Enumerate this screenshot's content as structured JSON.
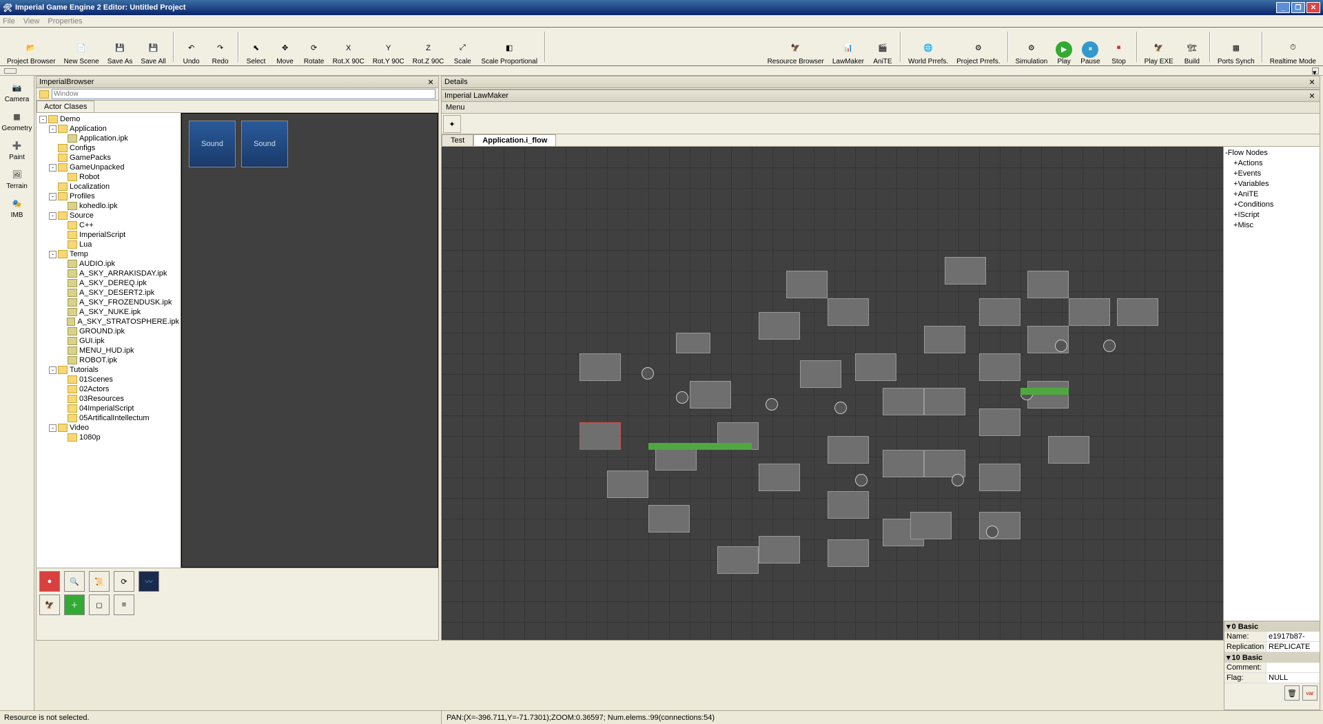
{
  "title": "Imperial Game Engine 2 Editor:  Untitled Project",
  "menu": {
    "file": "File",
    "view": "View",
    "properties": "Properties"
  },
  "toolbar": [
    {
      "id": "project-browser",
      "label": "Project Browser",
      "icon": "📂"
    },
    {
      "id": "new-scene",
      "label": "New Scene",
      "icon": "📄"
    },
    {
      "id": "save-as",
      "label": "Save As",
      "icon": "💾"
    },
    {
      "id": "save-all",
      "label": "Save All",
      "icon": "💾"
    },
    {
      "sep": true
    },
    {
      "id": "undo",
      "label": "Undo",
      "icon": "↶"
    },
    {
      "id": "redo",
      "label": "Redo",
      "icon": "↷"
    },
    {
      "sep": true
    },
    {
      "id": "select",
      "label": "Select",
      "icon": "⬉"
    },
    {
      "id": "move",
      "label": "Move",
      "icon": "✥"
    },
    {
      "id": "rotate",
      "label": "Rotate",
      "icon": "⟳"
    },
    {
      "id": "rotx",
      "label": "Rot.X 90C",
      "icon": "X"
    },
    {
      "id": "roty",
      "label": "Rot.Y 90C",
      "icon": "Y"
    },
    {
      "id": "rotz",
      "label": "Rot.Z 90C",
      "icon": "Z"
    },
    {
      "id": "scale",
      "label": "Scale",
      "icon": "⤢"
    },
    {
      "id": "scaleprop",
      "label": "Scale Proportional",
      "icon": "◧"
    },
    {
      "sep": true
    },
    {
      "spacer": true
    },
    {
      "id": "resourcebrowser",
      "label": "Resource Browser",
      "icon": "🦅"
    },
    {
      "id": "lawmaker",
      "label": "LawMaker",
      "icon": "📊"
    },
    {
      "id": "anite",
      "label": "AniTE",
      "icon": "🎬"
    },
    {
      "sep": true
    },
    {
      "id": "worldprefs",
      "label": "World Prrefs.",
      "icon": "🌐"
    },
    {
      "id": "projectprefs",
      "label": "Project Prrefs.",
      "icon": "⚙"
    },
    {
      "sep": true
    },
    {
      "id": "simulation",
      "label": "Simulation",
      "icon": "⚙"
    },
    {
      "id": "play",
      "label": "Play",
      "icon": "▶"
    },
    {
      "id": "pause",
      "label": "Pause",
      "icon": "⏸"
    },
    {
      "id": "stop",
      "label": "Stop",
      "icon": "⏹"
    },
    {
      "sep": true
    },
    {
      "id": "playexe",
      "label": "Play EXE",
      "icon": "🦅"
    },
    {
      "id": "build",
      "label": "Build",
      "icon": "🏗"
    },
    {
      "sep": true
    },
    {
      "id": "portssynch",
      "label": "Ports Synch",
      "icon": "▦"
    },
    {
      "sep": true
    },
    {
      "id": "realtimemode",
      "label": "Realtime Mode",
      "icon": "⏱"
    }
  ],
  "rail": [
    {
      "id": "camera",
      "label": "Camera",
      "icon": "📷"
    },
    {
      "id": "geometry",
      "label": "Geometry",
      "icon": "▦"
    },
    {
      "id": "paint",
      "label": "Paint",
      "icon": "➕"
    },
    {
      "id": "terrain",
      "label": "Terrain",
      "icon": "🖼"
    },
    {
      "id": "imb",
      "label": "IMB",
      "icon": "🎭"
    }
  ],
  "browser": {
    "title": "ImperialBrowser",
    "addr": "Window",
    "tab": "Actor Clases",
    "thumbs": [
      "Sound",
      "Sound"
    ],
    "tree": [
      {
        "t": "Demo",
        "exp": "-",
        "lvl": 0,
        "f": 1
      },
      {
        "t": "Application",
        "exp": "-",
        "lvl": 1,
        "f": 1
      },
      {
        "t": "Application.ipk",
        "lvl": 2,
        "file": 1
      },
      {
        "t": "Configs",
        "lvl": 1,
        "f": 1
      },
      {
        "t": "GamePacks",
        "lvl": 1,
        "f": 1
      },
      {
        "t": "GameUnpacked",
        "exp": "-",
        "lvl": 1,
        "f": 1
      },
      {
        "t": "Robot",
        "lvl": 2,
        "f": 1
      },
      {
        "t": "Localization",
        "lvl": 1,
        "f": 1
      },
      {
        "t": "Profiles",
        "exp": "-",
        "lvl": 1,
        "f": 1
      },
      {
        "t": "kohedlo.ipk",
        "lvl": 2,
        "file": 1
      },
      {
        "t": "Source",
        "exp": "-",
        "lvl": 1,
        "f": 1
      },
      {
        "t": "C++",
        "lvl": 2,
        "f": 1
      },
      {
        "t": "ImperialScript",
        "lvl": 2,
        "f": 1
      },
      {
        "t": "Lua",
        "lvl": 2,
        "f": 1
      },
      {
        "t": "Temp",
        "exp": "-",
        "lvl": 1,
        "f": 1
      },
      {
        "t": "AUDIO.ipk",
        "lvl": 2,
        "file": 1
      },
      {
        "t": "A_SKY_ARRAKISDAY.ipk",
        "lvl": 2,
        "file": 1
      },
      {
        "t": "A_SKY_DEREQ.ipk",
        "lvl": 2,
        "file": 1
      },
      {
        "t": "A_SKY_DESERT2.ipk",
        "lvl": 2,
        "file": 1
      },
      {
        "t": "A_SKY_FROZENDUSK.ipk",
        "lvl": 2,
        "file": 1
      },
      {
        "t": "A_SKY_NUKE.ipk",
        "lvl": 2,
        "file": 1
      },
      {
        "t": "A_SKY_STRATOSPHERE.ipk",
        "lvl": 2,
        "file": 1
      },
      {
        "t": "GROUND.ipk",
        "lvl": 2,
        "file": 1
      },
      {
        "t": "GUI.ipk",
        "lvl": 2,
        "file": 1
      },
      {
        "t": "MENU_HUD.ipk",
        "lvl": 2,
        "file": 1
      },
      {
        "t": "ROBOT.ipk",
        "lvl": 2,
        "file": 1
      },
      {
        "t": "Tutorials",
        "exp": "-",
        "lvl": 1,
        "f": 1
      },
      {
        "t": "01Scenes",
        "lvl": 2,
        "f": 1
      },
      {
        "t": "02Actors",
        "lvl": 2,
        "f": 1
      },
      {
        "t": "03Resources",
        "lvl": 2,
        "f": 1
      },
      {
        "t": "04ImperialScript",
        "lvl": 2,
        "f": 1
      },
      {
        "t": "05ArtificalIntellectum",
        "lvl": 2,
        "f": 1
      },
      {
        "t": "Video",
        "exp": "-",
        "lvl": 1,
        "f": 1
      },
      {
        "t": "1080p",
        "lvl": 2,
        "f": 1
      }
    ]
  },
  "details": {
    "title": "Details"
  },
  "lawmaker": {
    "title": "Imperial LawMaker",
    "menu": "Menu",
    "tabs": [
      {
        "label": "Test",
        "active": false
      },
      {
        "label": "Application.i_flow",
        "active": true
      }
    ],
    "flownodes": [
      {
        "t": "Flow Nodes",
        "exp": "-",
        "lvl": 0
      },
      {
        "t": "Actions",
        "exp": "+",
        "lvl": 1
      },
      {
        "t": "Events",
        "exp": "+",
        "lvl": 1
      },
      {
        "t": "Variables",
        "exp": "+",
        "lvl": 1
      },
      {
        "t": "AniTE",
        "exp": "+",
        "lvl": 1
      },
      {
        "t": "Conditions",
        "exp": "+",
        "lvl": 1
      },
      {
        "t": "IScript",
        "exp": "+",
        "lvl": 1
      },
      {
        "t": "Misc",
        "exp": "+",
        "lvl": 1
      }
    ]
  },
  "props": {
    "hdr1": "0 Basic",
    "name_k": "Name:",
    "name_v": "e1917b87-",
    "rep_k": "Replication",
    "rep_v": "REPLICATE",
    "hdr2": "10 Basic",
    "com_k": "Comment:",
    "com_v": "",
    "flag_k": "Flag:",
    "flag_v": "NULL"
  },
  "status": {
    "left": "Resource is not selected.",
    "right": "PAN:(X=-396.711,Y=-71.7301);ZOOM:0.36597; Num.elems.:99(connections:54)"
  }
}
